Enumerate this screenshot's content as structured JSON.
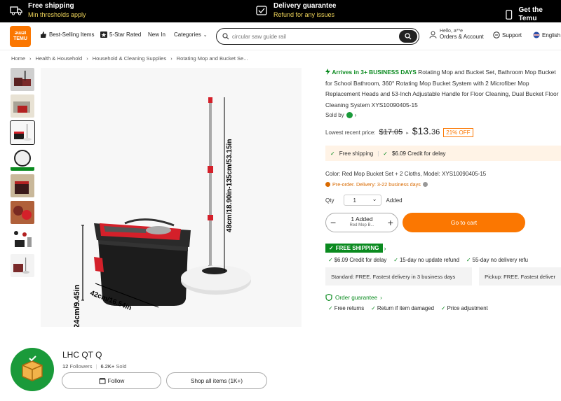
{
  "topbar": {
    "free_shipping_title": "Free shipping",
    "free_shipping_sub": "Min thresholds apply",
    "delivery_title": "Delivery guarantee",
    "delivery_sub": "Refund for any issues",
    "app_title": "Get the Temu"
  },
  "header": {
    "logo_top": "ǝɯǝʇ",
    "logo_bottom": "TEMU",
    "nav": [
      "Best-Selling Items",
      "5-Star Rated",
      "New In",
      "Categories"
    ],
    "search_placeholder": "circular saw guide rail",
    "hello": "Hello, a**e",
    "orders": "Orders & Account",
    "support": "Support",
    "language": "English"
  },
  "breadcrumb": [
    "Home",
    "Health & Household",
    "Household & Cleaning Supplies",
    "Rotating Mop and Bucket Se..."
  ],
  "product": {
    "arrives": "Arrives in 3+ BUSINESS DAYS",
    "title": "Rotating Mop and Bucket Set, Bathroom Mop Bucket for School Bathroom, 360° Rotating Mop Bucket System with 2 Microfiber Mop Replacement Heads and 53-Inch Adjustable Handle for Floor Cleaning, Dual Bucket Floor Cleaning System XYS10090405-15",
    "sold_by": "Sold by",
    "lowest_label": "Lowest recent price:",
    "old_price": "$17.05",
    "price_whole": "$13.",
    "price_dec": "36",
    "discount": "21% OFF",
    "free_shipping": "Free shipping",
    "credit": "$6.09 Credit for delay",
    "color": "Color: Red Mop Bucket Set + 2 Cloths, Model: XYS10090405-15",
    "preorder": "Pre-order. Delivery: 3-22 business days",
    "qty_label": "Qty",
    "qty_value": "1",
    "qty_added": "Added",
    "stepper_added": "1 Added",
    "stepper_sub": "Red Mop B...",
    "cart_button": "Go to cart",
    "free_ship_tag": "FREE SHIPPING",
    "ship_points": [
      "$6.09 Credit for delay",
      "15-day no update refund",
      "55-day no delivery refu"
    ],
    "standard": "Standard: FREE. Fastest delivery in 3 business days",
    "pickup": "Pickup: FREE. Fastest deliver",
    "order_guarantee": "Order guarantee",
    "guarantee_points": [
      "Free returns",
      "Return if item damaged",
      "Price adjustment"
    ],
    "dimensions": {
      "height": "24cm/9.45in",
      "width": "42cm/16.54in",
      "handle": "48cm/18.90in-135cm/53.15in"
    }
  },
  "store": {
    "name": "LHC QT Q",
    "followers_count": "12",
    "followers_label": "Followers",
    "sold_count": "6.2K+",
    "sold_label": "Sold",
    "follow": "Follow",
    "shop_all": "Shop all items (1K+)"
  },
  "colors": {
    "accent": "#fb7701",
    "green": "#0a8a1f",
    "bucket_red": "#d4202a",
    "bucket_black": "#1c1c1c"
  }
}
